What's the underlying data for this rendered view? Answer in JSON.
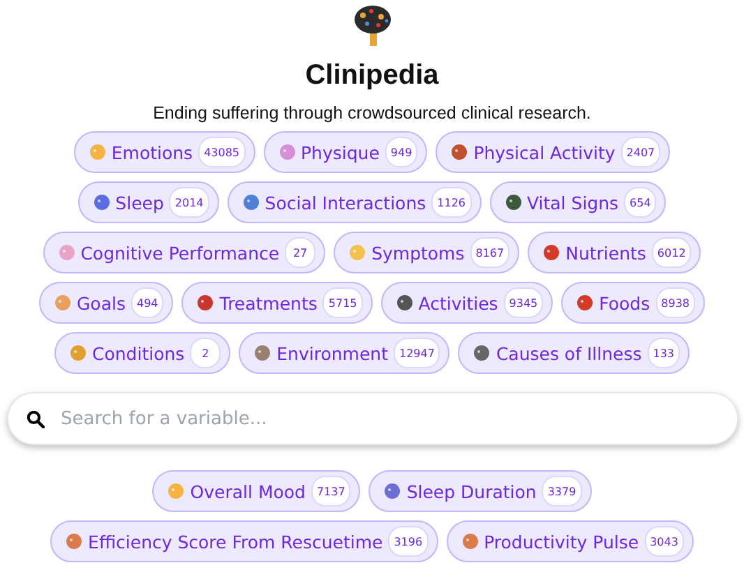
{
  "header": {
    "title": "Clinipedia",
    "tagline": "Ending suffering through crowdsourced clinical research."
  },
  "categories": [
    {
      "label": "Emotions",
      "count": "43085"
    },
    {
      "label": "Physique",
      "count": "949"
    },
    {
      "label": "Physical Activity",
      "count": "2407"
    },
    {
      "label": "Sleep",
      "count": "2014"
    },
    {
      "label": "Social Interactions",
      "count": "1126"
    },
    {
      "label": "Vital Signs",
      "count": "654"
    },
    {
      "label": "Cognitive Performance",
      "count": "27"
    },
    {
      "label": "Symptoms",
      "count": "8167"
    },
    {
      "label": "Nutrients",
      "count": "6012"
    },
    {
      "label": "Goals",
      "count": "494"
    },
    {
      "label": "Treatments",
      "count": "5715"
    },
    {
      "label": "Activities",
      "count": "9345"
    },
    {
      "label": "Foods",
      "count": "8938"
    },
    {
      "label": "Conditions",
      "count": "2"
    },
    {
      "label": "Environment",
      "count": "12947"
    },
    {
      "label": "Causes of Illness",
      "count": "133"
    }
  ],
  "search": {
    "placeholder": "Search for a variable..."
  },
  "variables": [
    {
      "label": "Overall Mood",
      "count": "7137"
    },
    {
      "label": "Sleep Duration",
      "count": "3379"
    },
    {
      "label": "Efficiency Score From Rescuetime",
      "count": "3196"
    },
    {
      "label": "Productivity Pulse",
      "count": "3043"
    }
  ]
}
